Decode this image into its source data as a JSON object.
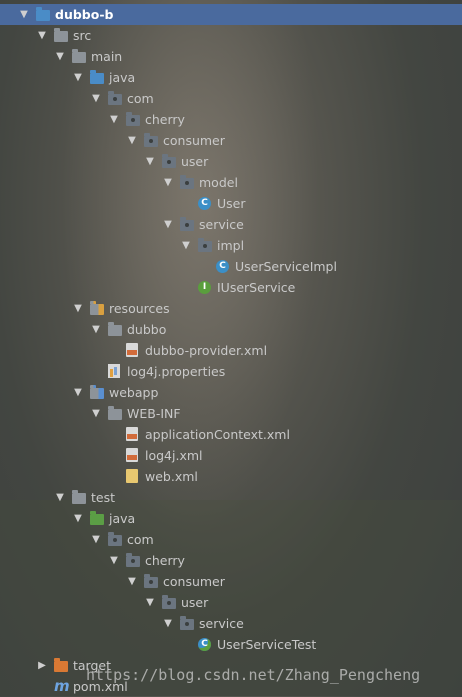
{
  "tree": [
    {
      "label": "dubbo-b",
      "indent": 0,
      "arrow": "▼",
      "icon": "module",
      "selected": true
    },
    {
      "label": "src",
      "indent": 1,
      "arrow": "▼",
      "icon": "folder-grey"
    },
    {
      "label": "main",
      "indent": 2,
      "arrow": "▼",
      "icon": "folder-grey"
    },
    {
      "label": "java",
      "indent": 3,
      "arrow": "▼",
      "icon": "folder-blue"
    },
    {
      "label": "com",
      "indent": 4,
      "arrow": "▼",
      "icon": "package"
    },
    {
      "label": "cherry",
      "indent": 5,
      "arrow": "▼",
      "icon": "package"
    },
    {
      "label": "consumer",
      "indent": 6,
      "arrow": "▼",
      "icon": "package"
    },
    {
      "label": "user",
      "indent": 7,
      "arrow": "▼",
      "icon": "package"
    },
    {
      "label": "model",
      "indent": 8,
      "arrow": "▼",
      "icon": "package"
    },
    {
      "label": "User",
      "indent": 9,
      "arrow": "",
      "icon": "class"
    },
    {
      "label": "service",
      "indent": 8,
      "arrow": "▼",
      "icon": "package"
    },
    {
      "label": "impl",
      "indent": 9,
      "arrow": "▼",
      "icon": "package"
    },
    {
      "label": "UserServiceImpl",
      "indent": 10,
      "arrow": "",
      "icon": "class"
    },
    {
      "label": "IUserService",
      "indent": 9,
      "arrow": "",
      "icon": "interface"
    },
    {
      "label": "resources",
      "indent": 3,
      "arrow": "▼",
      "icon": "folder-resources"
    },
    {
      "label": "dubbo",
      "indent": 4,
      "arrow": "▼",
      "icon": "folder-grey"
    },
    {
      "label": "dubbo-provider.xml",
      "indent": 5,
      "arrow": "",
      "icon": "xml"
    },
    {
      "label": "log4j.properties",
      "indent": 4,
      "arrow": "",
      "icon": "properties"
    },
    {
      "label": "webapp",
      "indent": 3,
      "arrow": "▼",
      "icon": "folder-web"
    },
    {
      "label": "WEB-INF",
      "indent": 4,
      "arrow": "▼",
      "icon": "folder-grey"
    },
    {
      "label": "applicationContext.xml",
      "indent": 5,
      "arrow": "",
      "icon": "xml"
    },
    {
      "label": "log4j.xml",
      "indent": 5,
      "arrow": "",
      "icon": "xml"
    },
    {
      "label": "web.xml",
      "indent": 5,
      "arrow": "",
      "icon": "web-xml"
    },
    {
      "label": "test",
      "indent": 2,
      "arrow": "▼",
      "icon": "folder-grey"
    },
    {
      "label": "java",
      "indent": 3,
      "arrow": "▼",
      "icon": "folder-green"
    },
    {
      "label": "com",
      "indent": 4,
      "arrow": "▼",
      "icon": "package"
    },
    {
      "label": "cherry",
      "indent": 5,
      "arrow": "▼",
      "icon": "package"
    },
    {
      "label": "consumer",
      "indent": 6,
      "arrow": "▼",
      "icon": "package"
    },
    {
      "label": "user",
      "indent": 7,
      "arrow": "▼",
      "icon": "package"
    },
    {
      "label": "service",
      "indent": 8,
      "arrow": "▼",
      "icon": "package"
    },
    {
      "label": "UserServiceTest",
      "indent": 9,
      "arrow": "",
      "icon": "test-class"
    },
    {
      "label": "target",
      "indent": 1,
      "arrow": "▶",
      "icon": "folder-orange"
    },
    {
      "label": "pom.xml",
      "indent": 1,
      "arrow": "",
      "icon": "maven"
    }
  ],
  "watermark": "https://blog.csdn.net/Zhang_Pengcheng",
  "colors": {
    "selection": "#4a6a9e",
    "source_root": "#4a8cc7",
    "test_root": "#5b9e45",
    "excluded": "#d97934",
    "class": "#3b8fc7",
    "interface": "#5a9e3d"
  }
}
